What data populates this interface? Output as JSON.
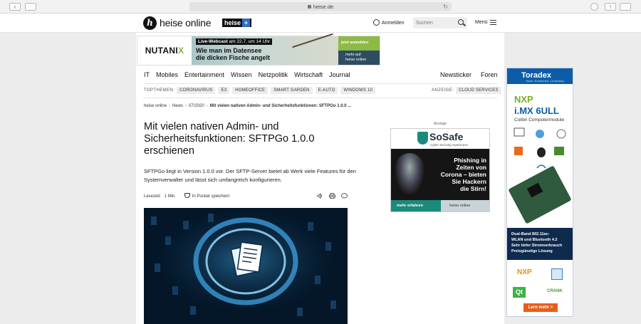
{
  "browser": {
    "url": "heise.de"
  },
  "header": {
    "logo_mark": "h",
    "logo_text": "heise online",
    "heiseplus_text": "heise",
    "heiseplus_plus": "+",
    "login_label": "Anmelden",
    "search_placeholder": "Suchen",
    "menu_label": "Menü"
  },
  "banner_ad": {
    "brand": "NUTANI",
    "brand_x": "X",
    "webcast_badge": "Live-Webcast",
    "webcast_date": "am 22.7. um 14 Uhr",
    "headline_1": "Wie man im Datensee",
    "headline_2": "die dicken Fische angelt",
    "cta": "jetzt anmelden",
    "footer_1": "mehr auf",
    "footer_2": "heise online"
  },
  "nav": {
    "items": [
      "IT",
      "Mobiles",
      "Entertainment",
      "Wissen",
      "Netzpolitik",
      "Wirtschaft",
      "Journal"
    ],
    "right": [
      "Newsticker",
      "Foren"
    ]
  },
  "topthemen": {
    "label": "TOPTHEMEN:",
    "chips": [
      "CORONAVIRUS",
      "E3",
      "HOMEOFFICE",
      "SMART GARDEN",
      "E-AUTO",
      "WINDOWS 10"
    ],
    "ad_label": "ANZEIGE:",
    "ad_chip": "CLOUD SERVICES"
  },
  "breadcrumb": {
    "items": [
      "heise online",
      "News",
      "07/2020"
    ],
    "current": "Mit vielen nativen Admin- und Sicherheitsfunktionen: SFTPGo 1.0.0 ..."
  },
  "article": {
    "title": "Mit vielen nativen Admin- und Sicherheitsfunktionen: SFTPGo 1.0.0 erschienen",
    "lead": "SFTPGo liegt in Version 1.0.0 vor. Der SFTP-Server bietet ab Werk viele Features für den Systemverwalter und lässt sich umfangreich konfigurieren.",
    "reading_label": "Lesezeit:",
    "reading_time": "1 Min.",
    "pocket_label": "In Pocket speichern"
  },
  "side_ad": {
    "label": "Anzeige",
    "brand": "SoSafe",
    "subtitle": "Cyber Security Awareness",
    "headline_1": "Phishing in",
    "headline_2": "Zeiten von",
    "headline_3": "Corona – bieten",
    "headline_4": "Sie Hackern",
    "headline_5": "die Stirn!",
    "cta": "mehr erfahren",
    "footer": "heise online"
  },
  "skyscraper": {
    "brand": "Toradex",
    "subtitle": "Swiss. Embedded. Computing.",
    "nxp": "NXP",
    "product": "i.MX 6ULL",
    "module": "Colibri Computermodule",
    "feature_1": "Dual-Band 802.11ac-",
    "feature_2": "WLAN und Bluetooth 4.2",
    "feature_3": "Sehr tiefer Stromverbrauch",
    "feature_4": "Preisgünstige Lösung",
    "nxp_logo": "NXP",
    "qt_logo": "Qt",
    "crank_logo": "CRANK",
    "cta": "Lern mehr >"
  },
  "colors": {
    "heise_blue": "#2b70c9",
    "nutanix_green": "#7fb23a",
    "sosafe_teal": "#1a8a7a",
    "toradex_blue": "#0d5ca7",
    "cta_orange": "#e85d1a"
  }
}
